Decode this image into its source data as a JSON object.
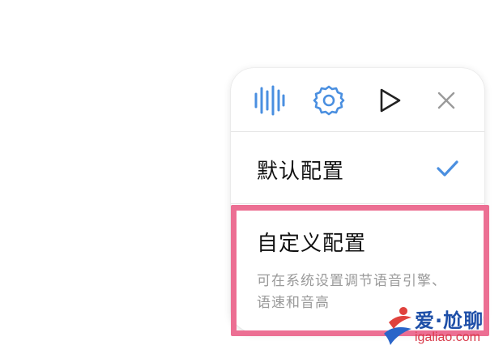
{
  "toolbar": {
    "icons": [
      "voice-waveform-icon",
      "gear-icon",
      "play-icon",
      "close-icon"
    ],
    "accent_color": "#4a8fe0"
  },
  "options": {
    "default": {
      "label": "默认配置",
      "selected": true,
      "check_icon": "checkmark-icon"
    },
    "custom": {
      "label": "自定义配置",
      "description": "可在系统设置调节语音引擎、语速和音高"
    }
  },
  "highlight": {
    "color": "#ec6f93"
  },
  "watermark": {
    "brand": "爱·尬聊",
    "url": "igaliao.com"
  }
}
